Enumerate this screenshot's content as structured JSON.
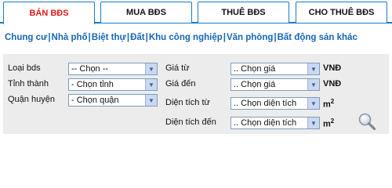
{
  "tabs": [
    {
      "label": "BÁN BĐS"
    },
    {
      "label": "MUA BĐS"
    },
    {
      "label": "THUÊ BĐS"
    },
    {
      "label": "CHO THUÊ BĐS"
    }
  ],
  "categories": [
    {
      "label": "Chung cư"
    },
    {
      "label": "Nhà phố"
    },
    {
      "label": "Biệt thự"
    },
    {
      "label": "Đất"
    },
    {
      "label": "Khu công nghiệp"
    },
    {
      "label": "Văn phòng"
    },
    {
      "label": "Bất động sản khác"
    }
  ],
  "separator": "|",
  "form": {
    "type": {
      "label": "Loại bds",
      "value": "-- Chọn --"
    },
    "province": {
      "label": "Tỉnh thành",
      "value": "- Chọn tỉnh"
    },
    "district": {
      "label": "Quận huyện",
      "value": "- Chọn quận"
    },
    "price_from": {
      "label": "Giá từ",
      "value": ".. Chọn giá",
      "unit": "VNĐ"
    },
    "price_to": {
      "label": "Giá đến",
      "value": ".. Chọn giá",
      "unit": "VNĐ"
    },
    "area_from": {
      "label": "Diện tích từ",
      "value": ".. Chọn diện tích",
      "unit": "m",
      "unit_sup": "2"
    },
    "area_to": {
      "label": "Diện tích đến",
      "value": ".. Chọn diện tích",
      "unit": "m",
      "unit_sup": "2"
    }
  },
  "icons": {
    "search": "magnifier-icon",
    "dropdown": "chevron-down-icon"
  },
  "colors": {
    "accent": "#1a7bc9",
    "active_tab_text": "#e01a1a",
    "link": "#1766b3",
    "panel_bg": "#ececec"
  }
}
